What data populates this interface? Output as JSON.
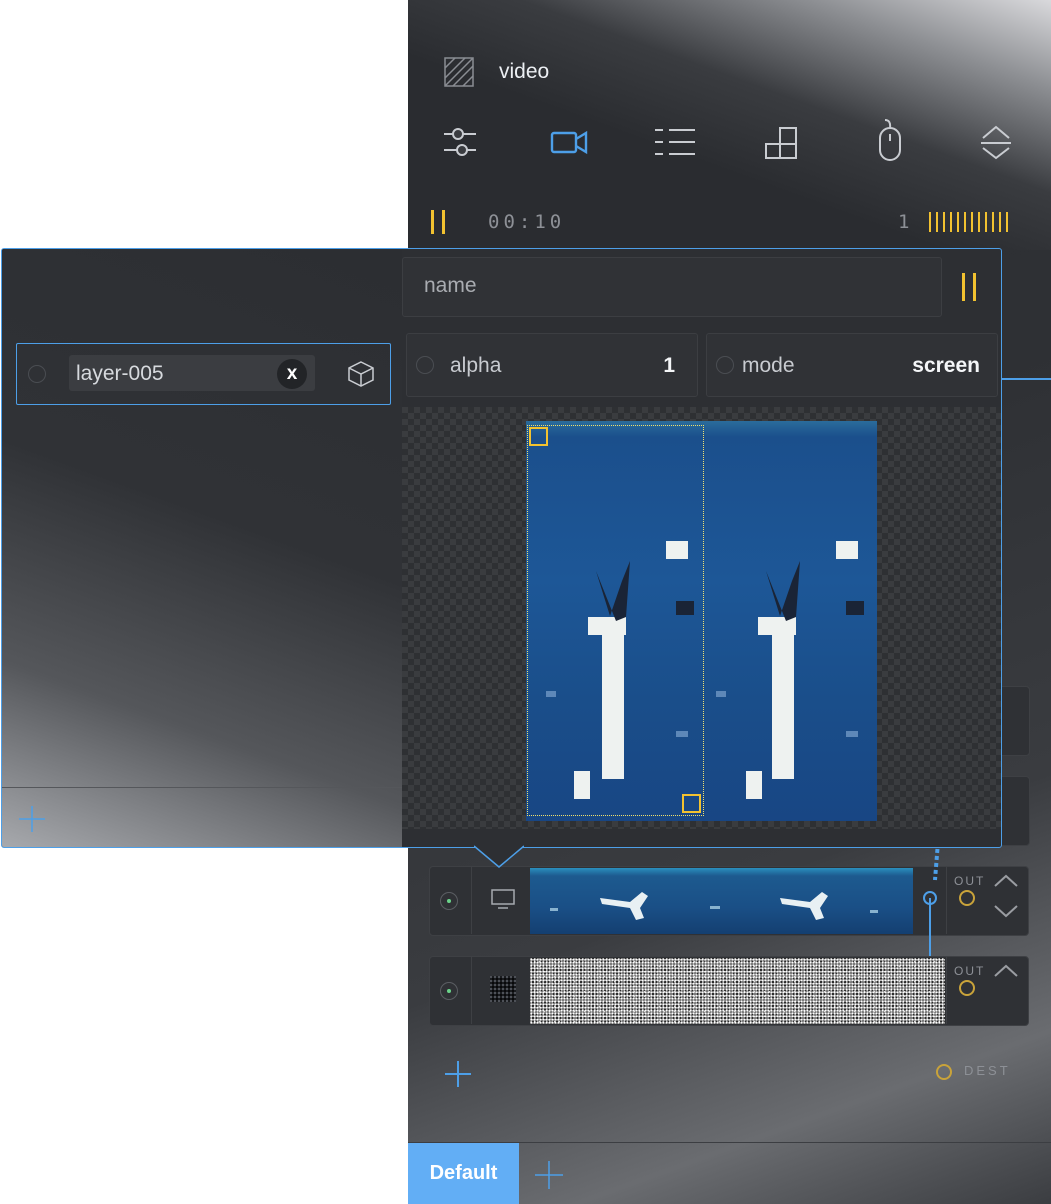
{
  "window": {
    "title": "video"
  },
  "toolbar": {
    "icons": [
      "sliders-icon",
      "video-camera-icon",
      "list-icon",
      "blocks-icon",
      "mouse-icon",
      "collapse-expand-icon"
    ]
  },
  "transport": {
    "time": "00:10",
    "frame": "1"
  },
  "popup": {
    "layer_name": "layer-005",
    "clear_label": "x",
    "name_placeholder": "name",
    "alpha_label": "alpha",
    "alpha_value": "1",
    "mode_label": "mode",
    "mode_value": "screen"
  },
  "layers": [
    {
      "type": "video",
      "out_label": "OUT"
    },
    {
      "type": "noise",
      "out_label": "OUT"
    }
  ],
  "dest": {
    "label": "DEST"
  },
  "bottom_tabs": {
    "default_label": "Default"
  },
  "colors": {
    "accent_blue": "#4d9fe8",
    "accent_yellow": "#f2c230",
    "tab_blue": "#62aef5",
    "green_dot": "#6bd48a"
  }
}
